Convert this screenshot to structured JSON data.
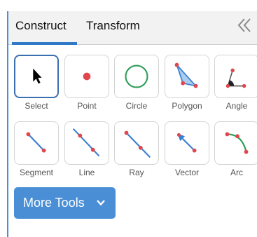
{
  "tabs": [
    {
      "label": "Construct",
      "active": true
    },
    {
      "label": "Transform",
      "active": false
    }
  ],
  "tools": [
    {
      "label": "Select",
      "icon": "select-arrow-icon",
      "selected": true
    },
    {
      "label": "Point",
      "icon": "point-icon",
      "selected": false
    },
    {
      "label": "Circle",
      "icon": "circle-icon",
      "selected": false
    },
    {
      "label": "Polygon",
      "icon": "polygon-icon",
      "selected": false
    },
    {
      "label": "Angle",
      "icon": "angle-icon",
      "selected": false
    },
    {
      "label": "Segment",
      "icon": "segment-icon",
      "selected": false
    },
    {
      "label": "Line",
      "icon": "line-icon",
      "selected": false
    },
    {
      "label": "Ray",
      "icon": "ray-icon",
      "selected": false
    },
    {
      "label": "Vector",
      "icon": "vector-icon",
      "selected": false
    },
    {
      "label": "Arc",
      "icon": "arc-icon",
      "selected": false
    }
  ],
  "more_tools": {
    "label": "More Tools",
    "icon": "chevron-down-icon"
  },
  "colors": {
    "accent": "#2f79c7",
    "button": "#4a8fd6",
    "point_red": "#e0474c",
    "line_blue": "#3b7fd0",
    "circle_green": "#2e9e5b",
    "arc_green": "#2e9e5b"
  }
}
